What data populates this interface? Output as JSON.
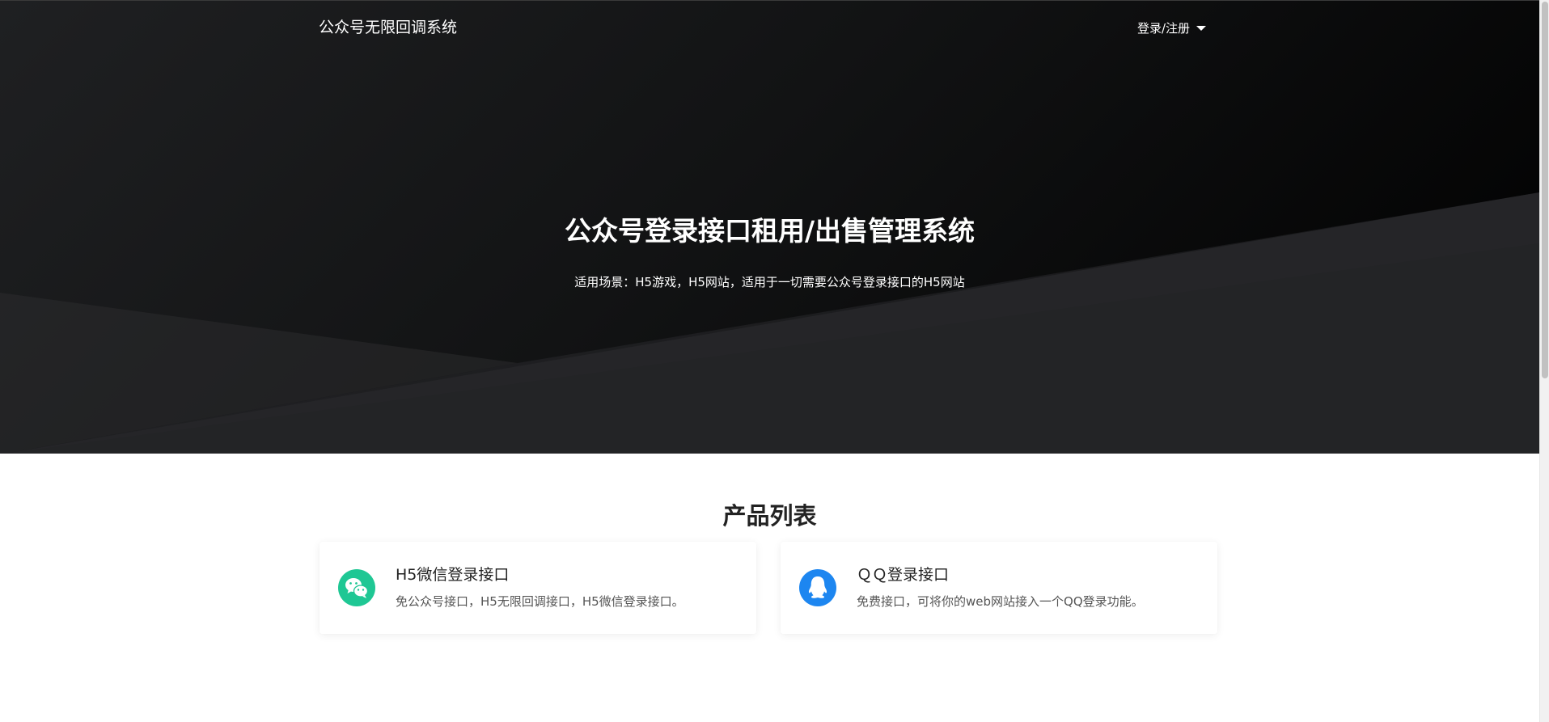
{
  "nav": {
    "brand": "公众号无限回调系统",
    "user_menu_label": "登录/注册"
  },
  "hero": {
    "title_parts": [
      "公众号登录",
      "接口",
      "租",
      "用",
      "/出售管理系统"
    ],
    "subtitle": "适用场景：H5游戏，H5网站，适用于一切需要公众号登录接口的H5网站"
  },
  "products": {
    "section_title": "产品列表",
    "items": [
      {
        "icon": "wechat-icon",
        "title": "H5微信登录接口",
        "description": "免公众号接口，H5无限回调接口，H5微信登录接口。",
        "color": "#1fc794"
      },
      {
        "icon": "qq-icon",
        "title": "ＱＱ登录接口",
        "description": "免费接口，可将你的web网站接入一个QQ登录功能。",
        "color": "#1d86f0"
      }
    ]
  },
  "colors": {
    "hero_dark": "#000000",
    "hero_light": "#1f2022",
    "wechat": "#1fc794",
    "qq": "#1d86f0"
  }
}
